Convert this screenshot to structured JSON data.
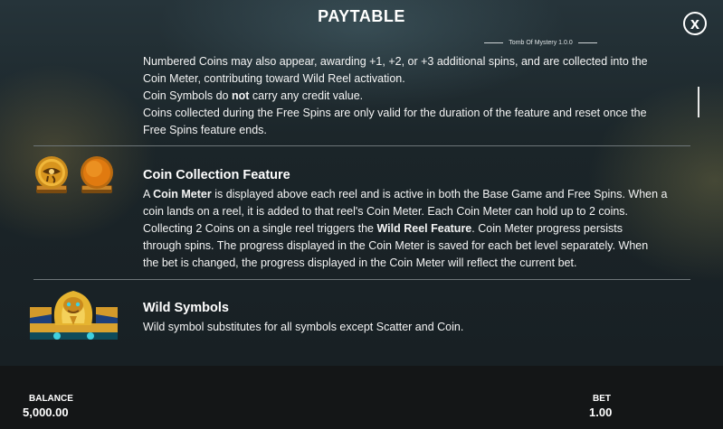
{
  "header": {
    "title": "PAYTABLE",
    "close_glyph": "x",
    "version": "Tomb Of Mystery 1.0.0"
  },
  "intro": {
    "line1": "Numbered Coins may also appear, awarding +1, +2, or +3 additional spins, and are collected into the",
    "line2": "Coin Meter, contributing toward Wild Reel activation.",
    "line3_pre": "Coin Symbols do ",
    "line3_bold": "not",
    "line3_post": " carry any credit value.",
    "line4": "Coins collected during the Free Spins are only valid for the duration of the feature and reset once the",
    "line5": "Free Spins feature ends."
  },
  "coin_section": {
    "heading": "Coin Collection Feature",
    "l1_a": "A ",
    "l1_b": "Coin Meter",
    "l1_c": " is displayed above each reel and is active in both the Base Game and Free Spins. When a",
    "l2": "coin lands on a reel, it is added to that reel's Coin Meter. Each Coin Meter can hold up to 2 coins.",
    "l3_a": "Collecting 2 Coins on a single reel triggers the ",
    "l3_b": "Wild Reel Feature",
    "l3_c": ". Coin Meter progress persists",
    "l4": "through spins. The progress displayed in the Coin Meter is saved for each bet level separately. When",
    "l5": "the bet is changed, the progress displayed in the Coin Meter will reflect the current bet.",
    "icons": [
      "eye-of-horus-coin-icon",
      "blank-gold-coin-icon"
    ]
  },
  "wild_section": {
    "heading": "Wild Symbols",
    "text": "Wild symbol substitutes for all symbols except Scatter and Coin.",
    "icon": "golden-cobra-wild-icon"
  },
  "footer": {
    "balance_label": "BALANCE",
    "balance_value": "5,000.00",
    "bet_label": "BET",
    "bet_value": "1.00"
  },
  "colors": {
    "gold": "#e0a526",
    "coin_orange": "#e07a10",
    "footer_bg": "#141617"
  }
}
